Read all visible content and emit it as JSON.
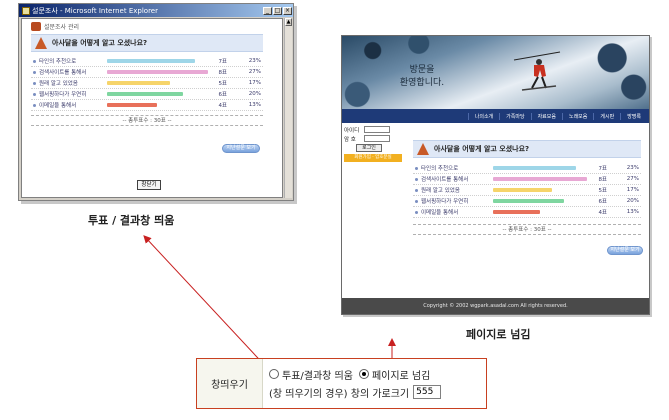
{
  "popup": {
    "title": "설문조사 - Microsoft Internet Explorer",
    "header": "설문조사 관리",
    "question": "아사달을 어떻게 알고 오셨나요?",
    "options": [
      {
        "label": "타인의 추천으로",
        "count": "7표",
        "percent": "23%",
        "ratio": 0.7,
        "color": "#9ed6e8"
      },
      {
        "label": "검색사이트를 통해서",
        "count": "8표",
        "percent": "27%",
        "ratio": 0.8,
        "color": "#e8a8d4"
      },
      {
        "label": "원래 알고 있었음",
        "count": "5표",
        "percent": "17%",
        "ratio": 0.5,
        "color": "#f6d46a"
      },
      {
        "label": "웹서핑하다가 우연히",
        "count": "6표",
        "percent": "20%",
        "ratio": 0.6,
        "color": "#7fd6a0"
      },
      {
        "label": "이메일을 통해서",
        "count": "4표",
        "percent": "13%",
        "ratio": 0.4,
        "color": "#e8705a"
      }
    ],
    "total": "-- 총투표수 : 30표 --",
    "prev_button": "지난설문 보기",
    "close_button": "창닫기"
  },
  "captions": {
    "left": "투표 / 결과창 띄움",
    "right": "페이지로 넘김"
  },
  "page": {
    "welcome_line1": "방문을",
    "welcome_line2": "환영합니다.",
    "nav": [
      "나의소개",
      "가족마당",
      "자료모음",
      "노래모음",
      "게시판",
      "방명록"
    ],
    "id_label": "아이디",
    "pw_label": "암 호",
    "login_button": "로그인",
    "links": "회원가입 · 암호분실",
    "footer": "Copyright © 2002 wgpark.asadal.com All rights reserved."
  },
  "option_box": {
    "label": "창띄우기",
    "radio1": "투표/결과창 띄움",
    "radio2": "페이지로 넘김",
    "width_label": "(창 띄우기의 경우) 창의 가로크기",
    "width_value": "555",
    "selected": "radio2"
  }
}
